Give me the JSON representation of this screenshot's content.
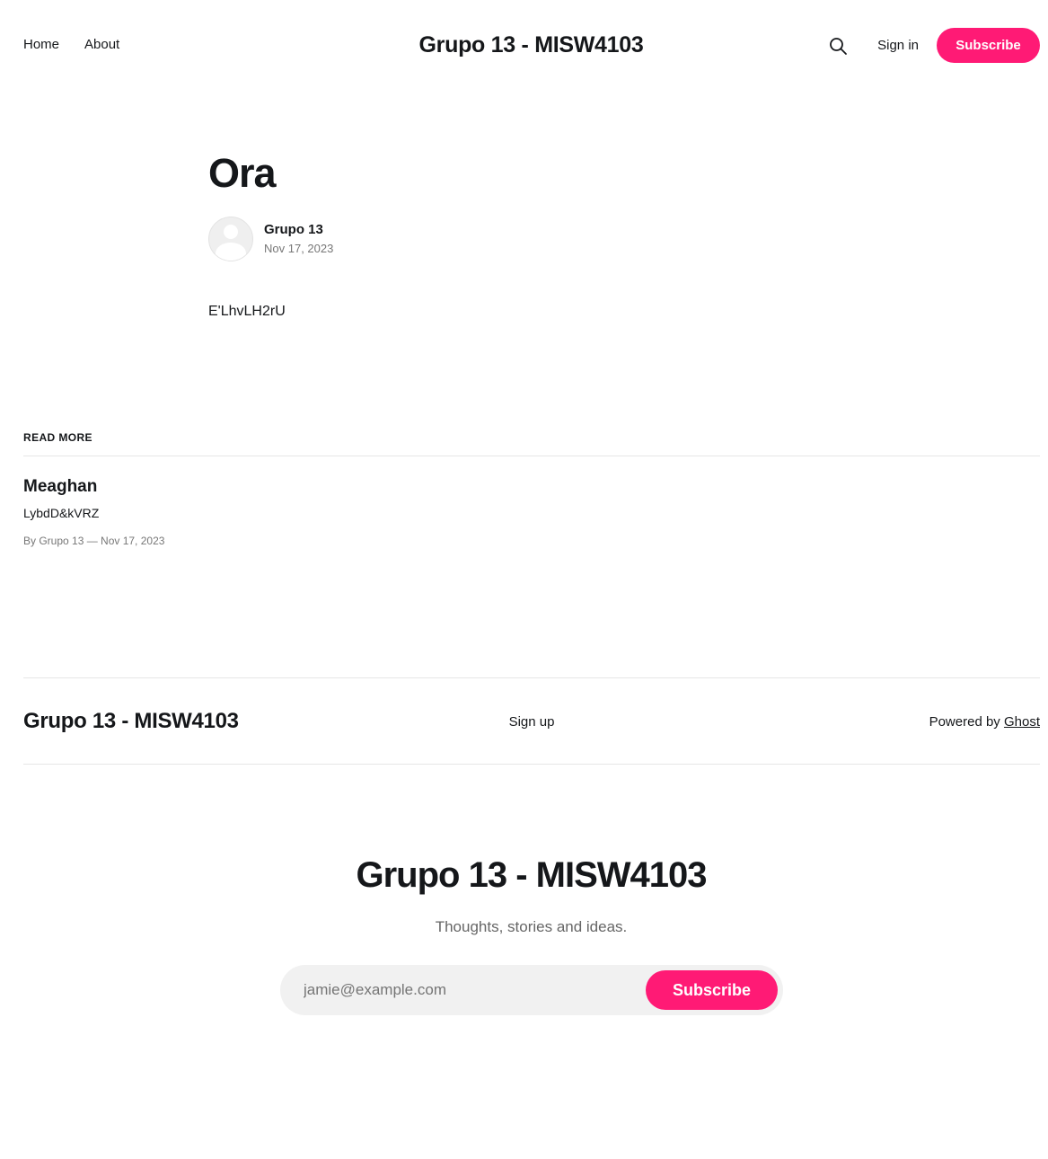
{
  "header": {
    "nav": [
      "Home",
      "About"
    ],
    "site_title": "Grupo 13 - MISW4103",
    "search_icon": "search-icon",
    "signin_label": "Sign in",
    "subscribe_label": "Subscribe"
  },
  "article": {
    "title": "Ora",
    "author": "Grupo 13",
    "date": "Nov 17, 2023",
    "body": "E'LhvLH2rU"
  },
  "read_more": {
    "label": "READ MORE",
    "card": {
      "title": "Meaghan",
      "excerpt": "LybdD&kVRZ",
      "meta": "By Grupo 13 — Nov 17, 2023"
    }
  },
  "footer": {
    "title": "Grupo 13 - MISW4103",
    "signup_label": "Sign up",
    "powered_prefix": "Powered by",
    "powered_link": "Ghost"
  },
  "cta": {
    "title": "Grupo 13 - MISW4103",
    "description": "Thoughts, stories and ideas.",
    "email_placeholder": "jamie@example.com",
    "button_label": "Subscribe"
  },
  "colors": {
    "accent": "#ff1a75",
    "text": "#15171a"
  }
}
